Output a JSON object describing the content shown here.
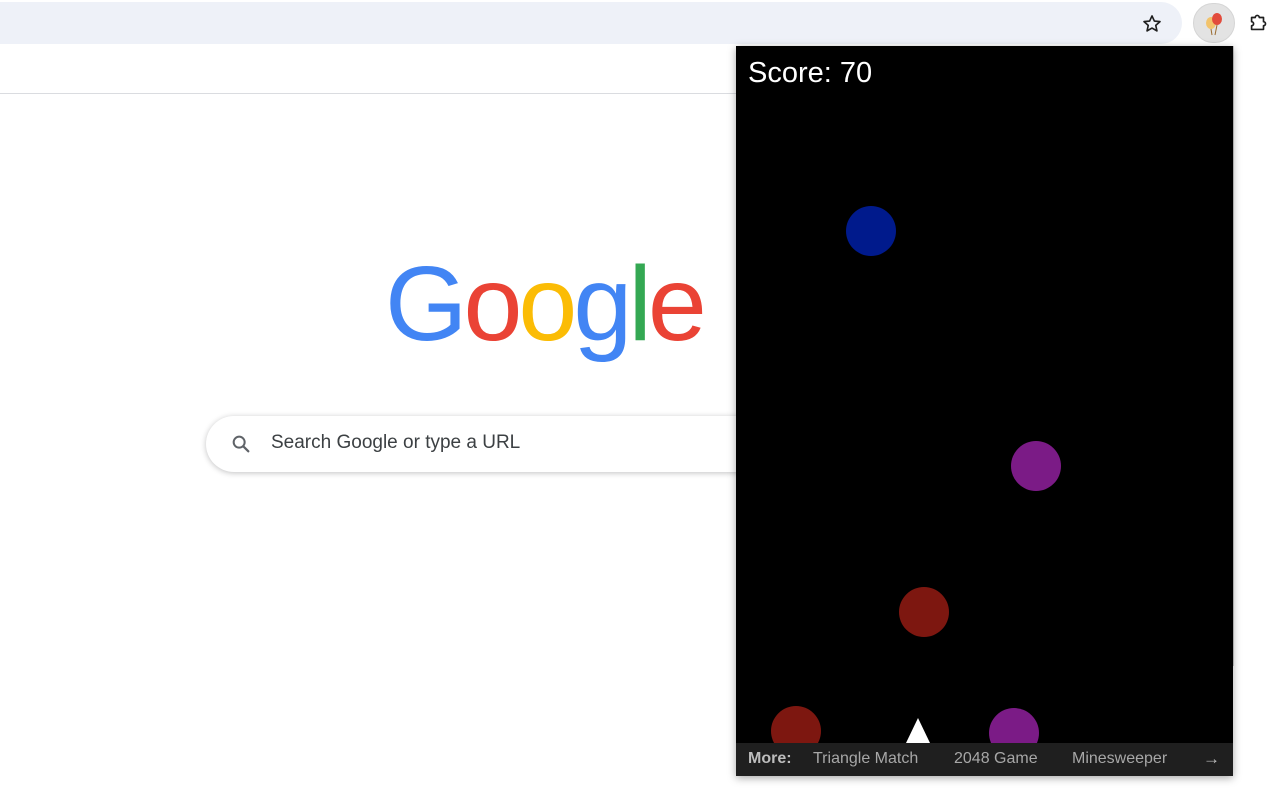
{
  "browser": {
    "star_icon": "star-outline-icon",
    "active_extension_icon": "balloons-icon",
    "extensions_icon": "puzzle-icon"
  },
  "ntp": {
    "logo_text": "Google",
    "logo_colors": [
      "#4285f4",
      "#ea4335",
      "#fbbc05",
      "#4285f4",
      "#34a853",
      "#ea4335"
    ],
    "search_placeholder": "Search Google or type a URL"
  },
  "game": {
    "score_label": "Score: 70",
    "balls": [
      {
        "color": "#001a8c"
      },
      {
        "color": "#7b1b86"
      },
      {
        "color": "#7d1710"
      },
      {
        "color": "#7d1710"
      },
      {
        "color": "#7b1b86"
      }
    ],
    "player": {
      "shape": "triangle",
      "color": "#ffffff"
    }
  },
  "more": {
    "label": "More:",
    "links": [
      "Triangle Match",
      "2048 Game",
      "Minesweeper"
    ],
    "arrow": "→"
  }
}
